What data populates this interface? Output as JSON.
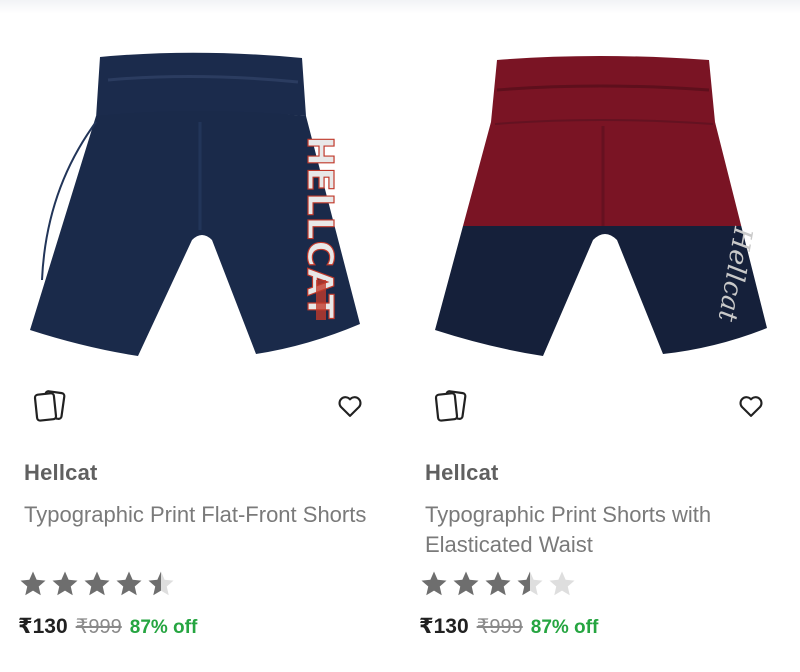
{
  "products": [
    {
      "brand": "Hellcat",
      "title": "Typographic Print Flat-Front Shorts",
      "rating": 4.5,
      "price": "₹130",
      "mrp": "₹999",
      "discount": "87% off",
      "print_text": "HELLCAT",
      "colors": {
        "main": "#1a2a4a",
        "print": "#c0392b"
      }
    },
    {
      "brand": "Hellcat",
      "title": "Typographic Print Shorts with Elasticated Waist",
      "rating": 3.5,
      "price": "₹130",
      "mrp": "₹999",
      "discount": "87% off",
      "print_text": "Hellcat",
      "colors": {
        "top": "#7a1424",
        "bottom": "#15203a"
      }
    }
  ],
  "icons": {
    "compare": "compare-cards-icon",
    "wishlist": "heart-outline-icon",
    "rating": "star-icon"
  },
  "colors": {
    "star_filled": "#6e6e6e",
    "star_empty": "#dedede",
    "discount": "#26a541"
  }
}
